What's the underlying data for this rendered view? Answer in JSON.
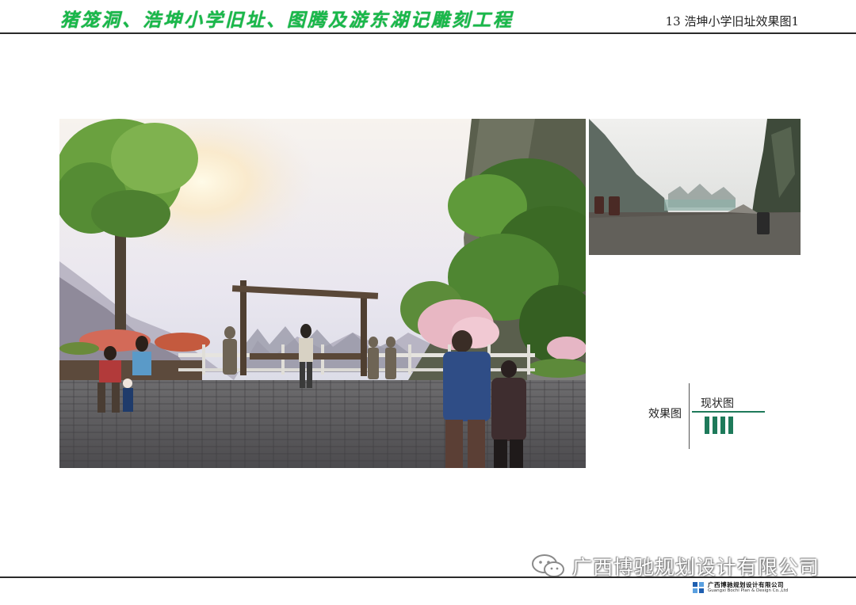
{
  "header": {
    "title": "猪笼洞、浩坤小学旧址、图腾及游东湖记雕刻工程",
    "page_label": "13  浩坤小学旧址效果图1",
    "title_color": "#19b84a"
  },
  "images": {
    "main": "park-scene-rendering",
    "status": "current-site-photo"
  },
  "legend": {
    "left_label": "效果图",
    "right_label": "现状图",
    "accent_color": "#1e7a5a"
  },
  "watermark": {
    "text": "广西博驰规划设计有限公司",
    "icon": "wechat-icon"
  },
  "footer_logo": {
    "cn": "广西博驰规划设计有限公司",
    "en": "Guangxi Bochi Plan & Design Co.,Ltd"
  }
}
